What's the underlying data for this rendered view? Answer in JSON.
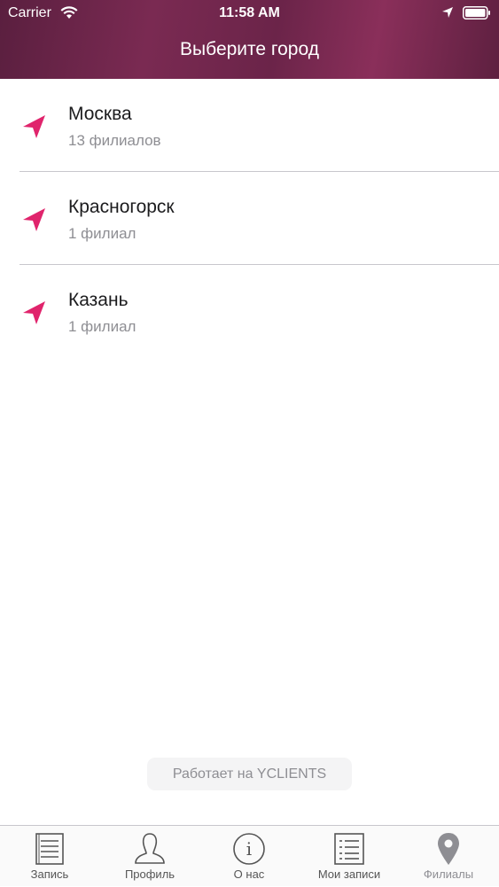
{
  "status_bar": {
    "carrier": "Carrier",
    "time": "11:58 AM"
  },
  "header": {
    "title": "Выберите город",
    "gradient_color": "#6b2449"
  },
  "accent_color": "#e0246c",
  "cities": [
    {
      "name": "Москва",
      "branches": "13 филиалов",
      "icon": "location-arrow-icon"
    },
    {
      "name": "Красногорск",
      "branches": "1 филиал",
      "icon": "location-arrow-icon"
    },
    {
      "name": "Казань",
      "branches": "1 филиал",
      "icon": "location-arrow-icon"
    }
  ],
  "powered_by": "Работает на YCLIENTS",
  "tabbar": {
    "items": [
      {
        "label": "Запись",
        "icon": "document-icon"
      },
      {
        "label": "Профиль",
        "icon": "person-icon"
      },
      {
        "label": "О нас",
        "icon": "info-icon"
      },
      {
        "label": "Мои записи",
        "icon": "list-icon"
      },
      {
        "label": "Филиалы",
        "icon": "map-pin-icon",
        "active": true
      }
    ]
  }
}
